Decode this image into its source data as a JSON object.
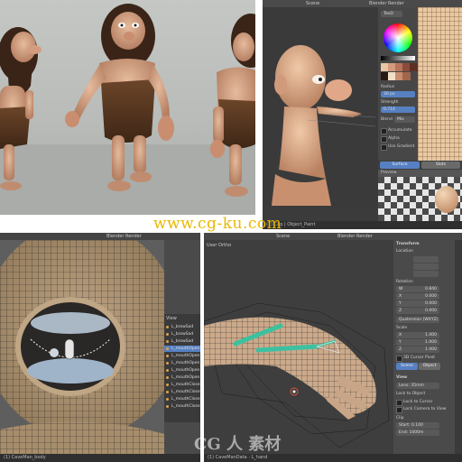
{
  "render_panel": {
    "status": "",
    "colors": {
      "floor": "#a8aba8",
      "skin": "#d9a88a",
      "hair": "#3a2418",
      "fur": "#5a3a22"
    }
  },
  "sculpt_panel": {
    "header": {
      "menu": "Scene",
      "engine": "Blender Render"
    },
    "brush": {
      "name_value": "TexD",
      "radius_label": "Radius",
      "radius_value": "30 px",
      "strength_label": "Strength",
      "strength_value": "0.714",
      "blend_label": "Blend",
      "blend_value": "Mix"
    },
    "options": [
      {
        "label": "Accumulate"
      },
      {
        "label": "Alpha"
      },
      {
        "label": "Use Gradient"
      }
    ],
    "tabs": [
      {
        "label": "Surface"
      },
      {
        "label": "Slots"
      }
    ],
    "subheader": "Preview",
    "bottom_bar": "(1) Cap | Object_Paint",
    "palette": [
      "#e8c7a2",
      "#d49a7c",
      "#b7745a",
      "#8b4c3a",
      "#5c2f24",
      "#2a1a14",
      "#f1e0c9",
      "#c98d6f",
      "#a0664c"
    ],
    "accent": "#5680c2"
  },
  "mouth_panel": {
    "header": {
      "engine": "Blender Render",
      "tab": "View"
    },
    "outliner": [
      {
        "label": "L_browSad"
      },
      {
        "label": "L_browSad"
      },
      {
        "label": "L_browSad"
      },
      {
        "label": "L_mouthOpen"
      },
      {
        "label": "L_mouthOpen"
      },
      {
        "label": "L_mouthOpen"
      },
      {
        "label": "L_mouthOpen"
      },
      {
        "label": "L_mouthOpen"
      },
      {
        "label": "L_mouthClose"
      },
      {
        "label": "L_mouthClose"
      },
      {
        "label": "L_mouthClose"
      },
      {
        "label": "L_mouthClose"
      }
    ],
    "bottom_bar": "(1) CaveMan_body"
  },
  "arm_panel": {
    "header": {
      "menu": "Scene",
      "engine": "Blender Render",
      "view_label": "User Ortho"
    },
    "transform": {
      "title": "Transform",
      "location_label": "Location",
      "rotation_label": "Rotation",
      "rotation_mode": "Quaternion (WXYZ)",
      "scale_label": "Scale",
      "rot_values": [
        {
          "axis": "W",
          "value": "0.840"
        },
        {
          "axis": "X",
          "value": "0.000"
        },
        {
          "axis": "Y",
          "value": "0.000"
        },
        {
          "axis": "Z",
          "value": "0.000"
        }
      ],
      "scale_values": [
        {
          "axis": "X",
          "value": "1.000"
        },
        {
          "axis": "Y",
          "value": "1.000"
        },
        {
          "axis": "Z",
          "value": "1.000"
        }
      ]
    },
    "pivot": {
      "label": "3D Cursor Pivot",
      "scene_btn": "Scene",
      "object_btn": "Object"
    },
    "view": {
      "title": "View",
      "lens_label": "Lens",
      "lens_value": "35mm",
      "lock_object": "Lock to Object",
      "lock_cursor": "Lock to Cursor",
      "lock_camera": "Lock Camera to View",
      "clip_title": "Clip",
      "start_label": "Start",
      "start_value": "0.100",
      "end_label": "End",
      "end_value": "1000m"
    },
    "bottom_bar": "(1) CaveManData : L_hand",
    "bone_color": "#3cc1a0"
  },
  "watermarks": {
    "top": "www.cg-ku.com",
    "bottom": "CG 人 素材"
  }
}
